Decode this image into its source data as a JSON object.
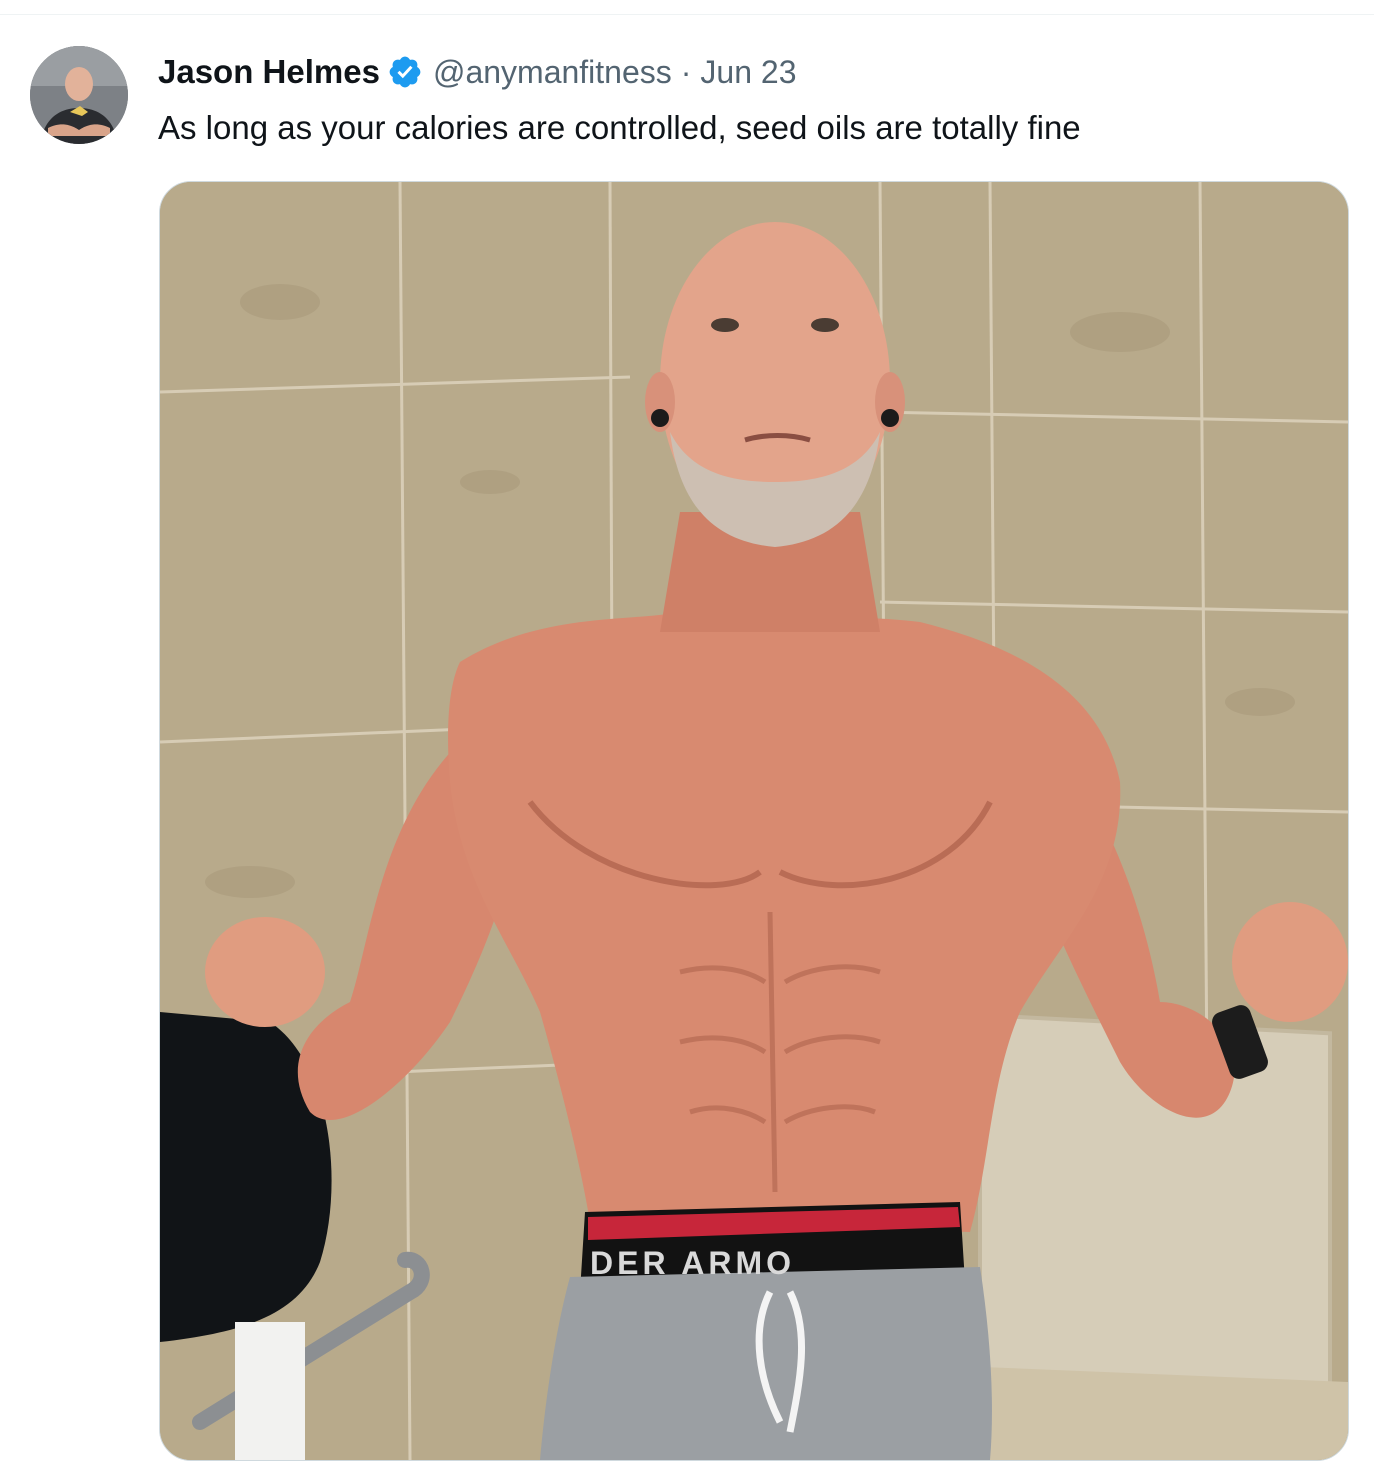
{
  "tweet": {
    "author": {
      "display_name": "Jason Helmes",
      "handle": "@anymanfitness",
      "verified": true,
      "avatar_icon": "profile-photo-avatar"
    },
    "separator": "·",
    "date": "Jun 23",
    "text": "As long as your calories are controlled, seed oils are totally fine",
    "media": {
      "type": "photo",
      "waistband_text": "DER ARMO"
    }
  },
  "colors": {
    "text_primary": "#0f1419",
    "text_secondary": "#536471",
    "verified_blue": "#1d9bf0",
    "border": "#cfd9de"
  }
}
